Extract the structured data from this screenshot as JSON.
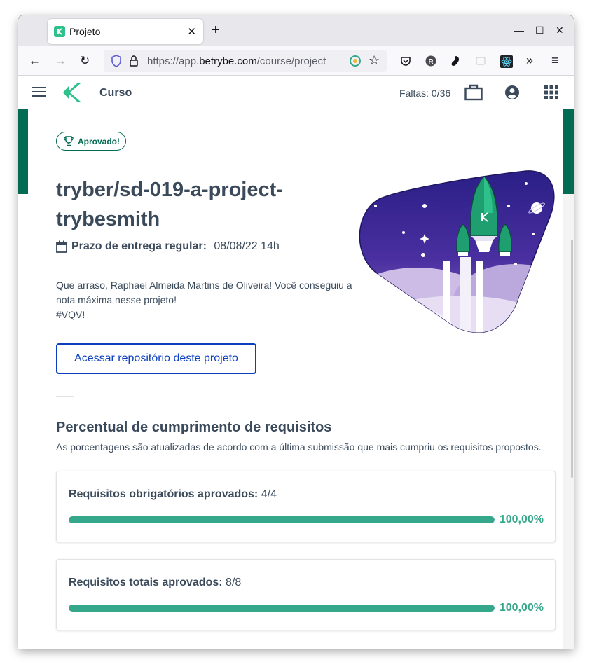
{
  "browser": {
    "tab_title": "Projeto",
    "url_host": "https://app.",
    "url_domain": "betrybe.com",
    "url_path": "/course/project"
  },
  "header": {
    "section": "Curso",
    "absences": "Faltas: 0/36"
  },
  "project": {
    "status_badge": "Aprovado!",
    "title": "tryber/sd-019-a-project-trybesmith",
    "deadline_label": "Prazo de entrega regular:",
    "deadline_value": "08/08/22 14h",
    "congrats_line1": "Que arraso, Raphael Almeida Martins de Oliveira! Você conseguiu a nota máxima nesse projeto!",
    "congrats_line2": "#VQV!",
    "repo_button": "Acessar repositório deste projeto"
  },
  "requirements": {
    "title": "Percentual de cumprimento de requisitos",
    "subtitle": "As porcentagens são atualizadas de acordo com a última submissão que mais cumpriu os requisitos propostos.",
    "items": [
      {
        "label": "Requisitos obrigatórios aprovados:",
        "value": "4/4",
        "percent_text": "100,00%",
        "fill_percent": 100
      },
      {
        "label": "Requisitos totais aprovados:",
        "value": "8/8",
        "percent_text": "100,00%",
        "fill_percent": 100
      }
    ]
  },
  "colors": {
    "brand_green": "#036b52",
    "progress_green": "#35a78a",
    "link_blue": "#0b3fbd",
    "text": "#3a4a5b"
  }
}
